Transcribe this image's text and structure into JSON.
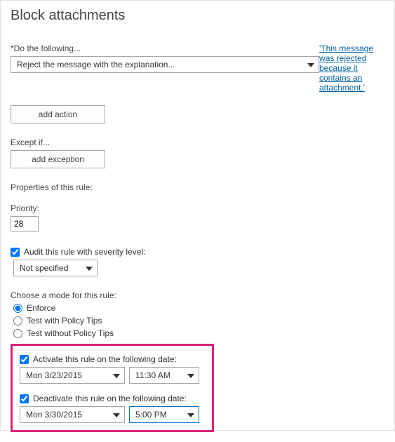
{
  "page": {
    "title": "Block attachments"
  },
  "do_following": {
    "label": "*Do the following...",
    "select_value": "Reject the message with the explanation..."
  },
  "explanation_link": "'This message was rejected because it contains an attachment.'",
  "buttons": {
    "add_action": "add action",
    "add_exception": "add exception"
  },
  "except_if": {
    "label": "Except if..."
  },
  "properties_header": "Properties of this rule:",
  "priority": {
    "label": "Priority:",
    "value": "28"
  },
  "audit": {
    "label": "Audit this rule with severity level:",
    "checked": true,
    "select_value": "Not specified"
  },
  "mode": {
    "label": "Choose a mode for this rule:",
    "options": {
      "enforce": "Enforce",
      "test_tips": "Test with Policy Tips",
      "test_notips": "Test without Policy Tips"
    },
    "selected": "enforce"
  },
  "activate": {
    "label": "Activate this rule on the following date:",
    "checked": true,
    "date": "Mon 3/23/2015",
    "time": "11:30 AM"
  },
  "deactivate": {
    "label": "Deactivate this rule on the following date:",
    "checked": true,
    "date": "Mon 3/30/2015",
    "time": "5:00 PM"
  }
}
